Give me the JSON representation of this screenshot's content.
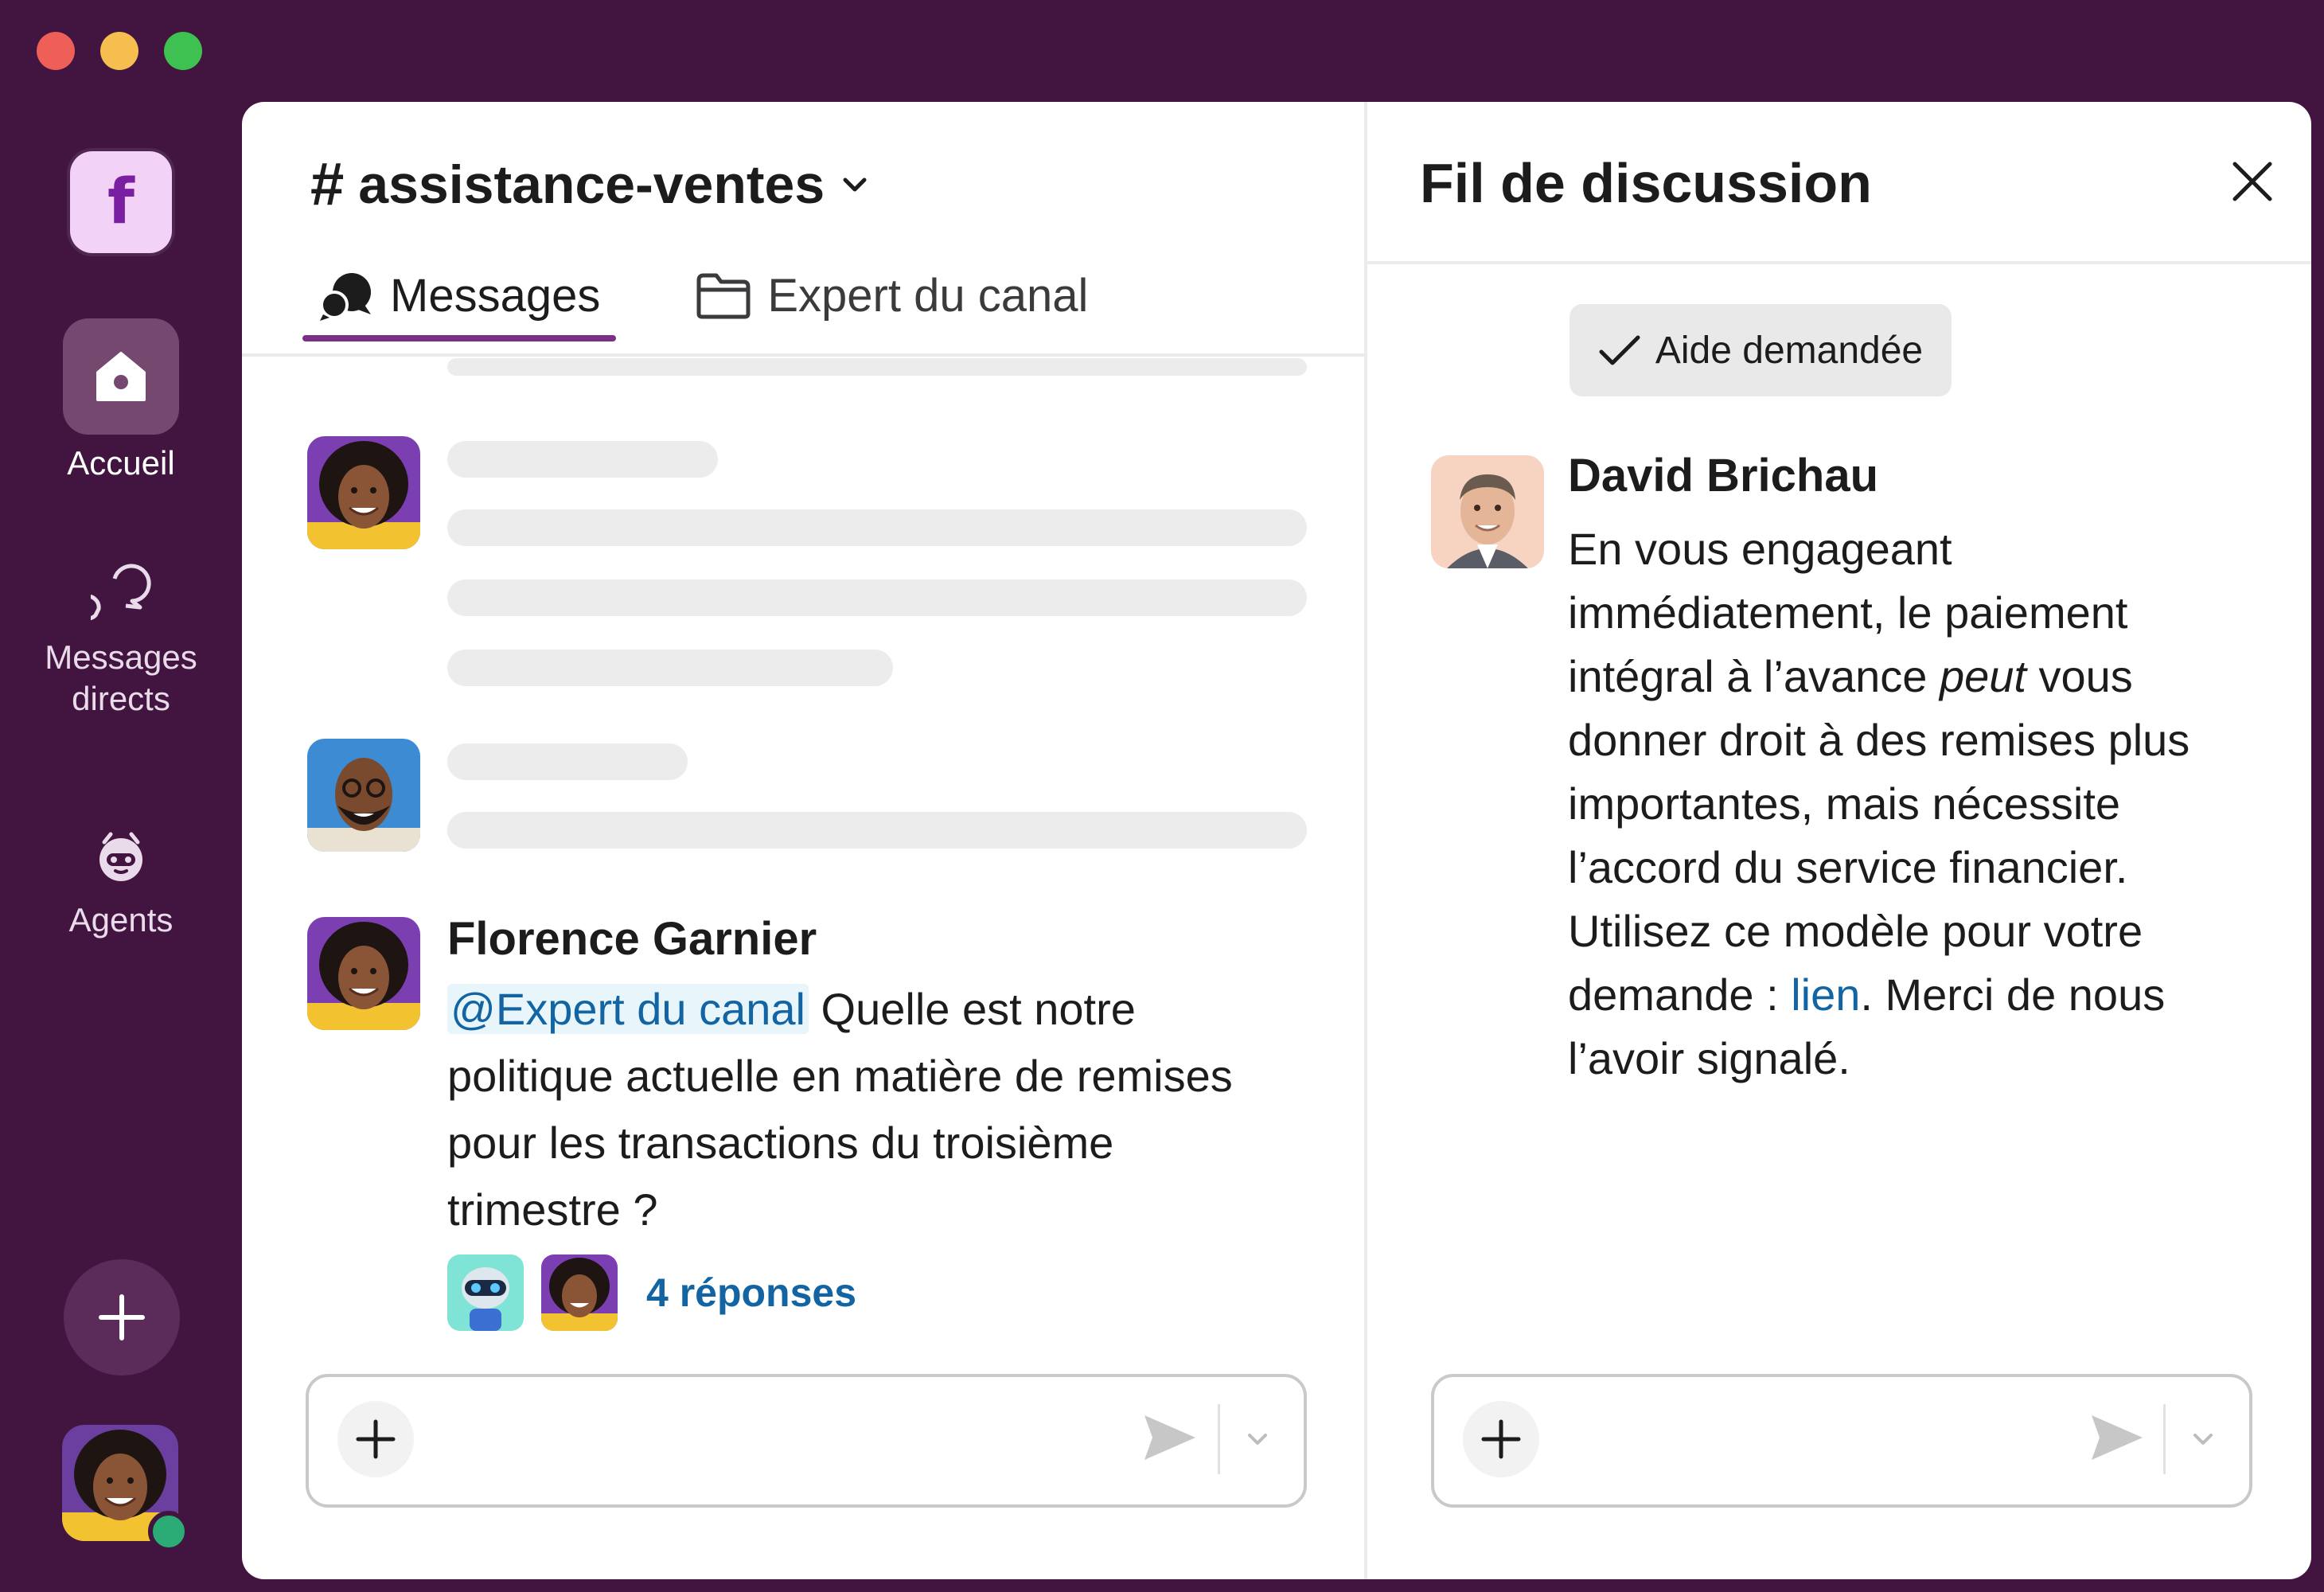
{
  "window_controls": [
    "close",
    "minimize",
    "zoom"
  ],
  "workspace": {
    "initial": "f"
  },
  "sidebar": {
    "items": [
      {
        "label": "Accueil",
        "icon": "home-icon",
        "active": true
      },
      {
        "label": "Messages directs",
        "icon": "direct-messages-icon",
        "active": false
      },
      {
        "label": "Agents",
        "icon": "agent-icon",
        "active": false
      }
    ],
    "add_icon": "plus-icon",
    "presence": "active"
  },
  "channel": {
    "hash": "#",
    "name": "assistance-ventes",
    "tabs": [
      {
        "label": "Messages",
        "icon": "messages-icon",
        "active": true
      },
      {
        "label": "Expert du canal",
        "icon": "folder-icon",
        "active": false
      }
    ]
  },
  "message": {
    "author": "Florence Garnier",
    "mention": "@Expert du canal",
    "text": "Quelle est notre politique actuelle en matière de remises pour les transactions du troisième trimestre ?",
    "replies_label": "4 réponses"
  },
  "thread": {
    "title": "Fil de discussion",
    "status_pill": "Aide demandée",
    "reply": {
      "author": "David Brichau",
      "text_part1": "En vous engageant immédiatement, le paiement intégral à l’avance ",
      "text_italic": "peut",
      "text_part2": " vous donner droit à des remises plus importantes, mais nécessite l’accord du service financier. Utilisez ce modèle pour votre demande : ",
      "link": "lien",
      "text_part3": ". Merci de nous l’avoir signalé."
    }
  },
  "colors": {
    "aubergine": "#411540",
    "accent": "#7c3085",
    "link": "#1264a3",
    "presence": "#2bac76"
  }
}
